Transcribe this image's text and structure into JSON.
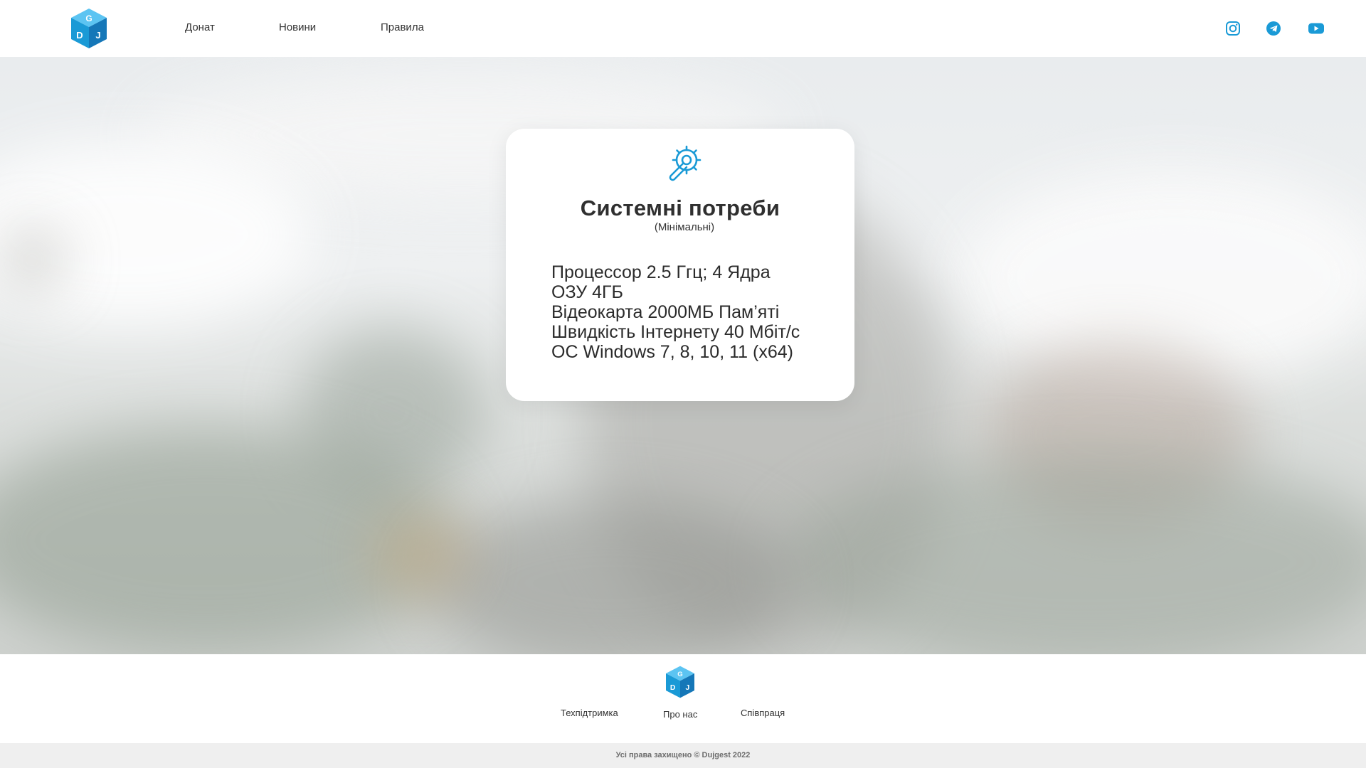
{
  "header": {
    "logo_text": "DGJ",
    "nav": {
      "donate": "Донат",
      "news": "Новини",
      "rules": "Правила"
    },
    "social": [
      "instagram-icon",
      "telegram-icon",
      "youtube-icon"
    ]
  },
  "card": {
    "icon": "wrench-gear-icon",
    "title": "Системні потреби",
    "subtitle": "(Мінімальні)",
    "specs": [
      "Процессор 2.5 Ггц; 4 Ядра",
      "ОЗУ 4ГБ",
      "Відеокарта 2000МБ Пам’яті",
      "Швидкість Інтернету 40 Мбіт/с",
      "ОС Windows 7, 8, 10, 11 (x64)"
    ]
  },
  "footer": {
    "support": "Техпідтримка",
    "about": "Про нас",
    "partnership": "Співпраця",
    "copyright": "Усі права захищено © Dujgest 2022"
  },
  "colors": {
    "accent": "#1a9ad6",
    "accent_dark": "#1577b8",
    "text": "#2b2b2b",
    "copyright_bg": "#efefef"
  }
}
